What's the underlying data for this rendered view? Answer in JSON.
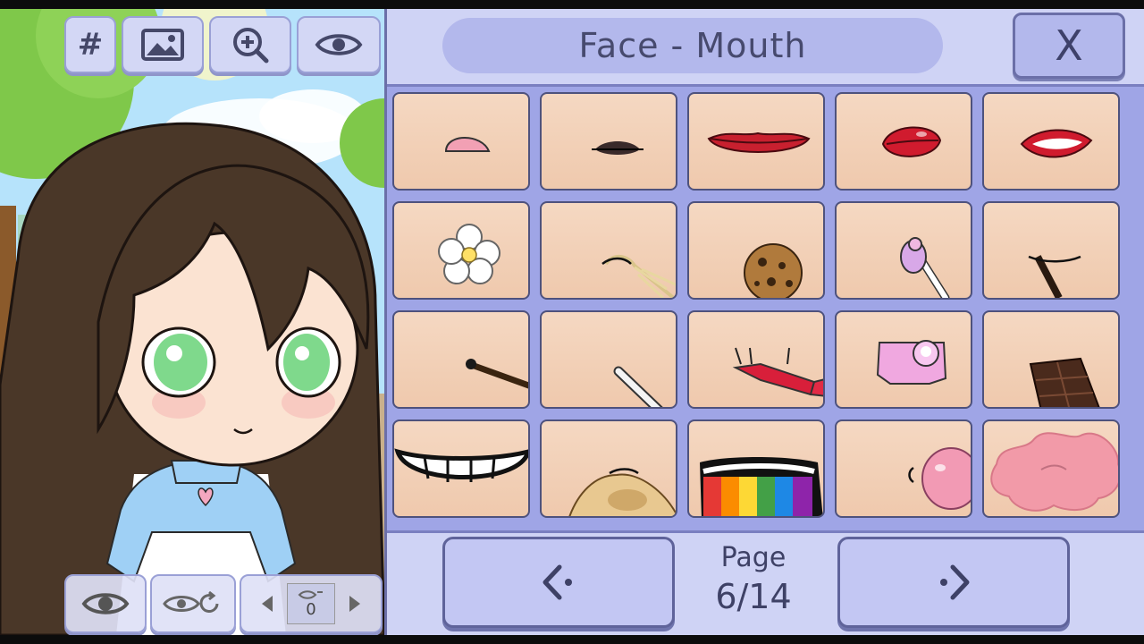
{
  "panel": {
    "title": "Face - Mouth",
    "close_label": "X",
    "page_label": "Page",
    "page_value": "6/14"
  },
  "toolbar": {
    "grid_label": "#"
  },
  "bottom_controls": {
    "counter_value": "0"
  },
  "grid": {
    "items": [
      "small-pink-mouth-icon",
      "small-dark-lips-icon",
      "red-smile-lips-icon",
      "red-pout-lips-icon",
      "red-open-lips-icon",
      "flower-in-mouth-icon",
      "wheat-straw-icon",
      "cookie-icon",
      "lollipop-icon",
      "chocolate-stick-icon",
      "pocky-stick-icon",
      "straw-icon",
      "wrapped-candy-icon",
      "pink-candy-icon",
      "chocolate-bar-icon",
      "toothy-grin-icon",
      "bread-toast-icon",
      "rainbow-vomit-icon",
      "bubblegum-bubble-icon",
      "pink-gum-splat-icon"
    ]
  }
}
